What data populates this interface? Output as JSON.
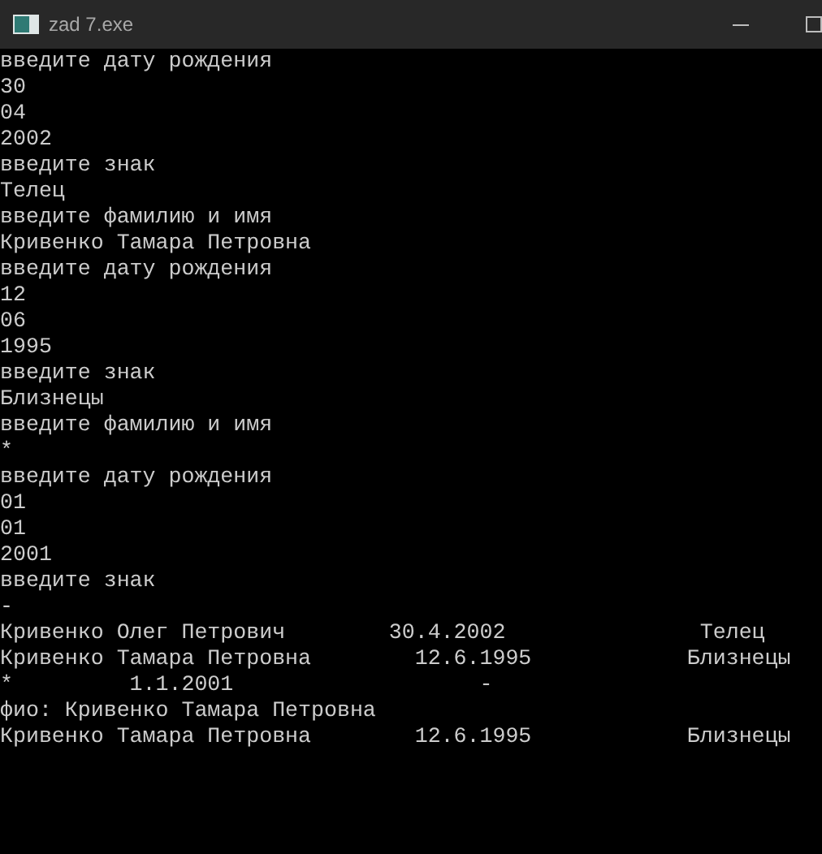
{
  "window": {
    "title": "zad 7.exe"
  },
  "console": {
    "lines": [
      "введите дату рождения",
      "30",
      "04",
      "2002",
      "введите знак",
      "Телец",
      "введите фамилию и имя",
      "Кривенко Тамара Петровна",
      "введите дату рождения",
      "12",
      "06",
      "1995",
      "введите знак",
      "Близнецы",
      "введите фамилию и имя",
      "*",
      "введите дату рождения",
      "01",
      "01",
      "2001",
      "введите знак",
      "-",
      "Кривенко Олег Петрович        30.4.2002               Телец",
      "Кривенко Тамара Петровна        12.6.1995            Близнецы",
      "*         1.1.2001                   -",
      "фио: Кривенко Тамара Петровна",
      "Кривенко Тамара Петровна        12.6.1995            Близнецы"
    ]
  }
}
